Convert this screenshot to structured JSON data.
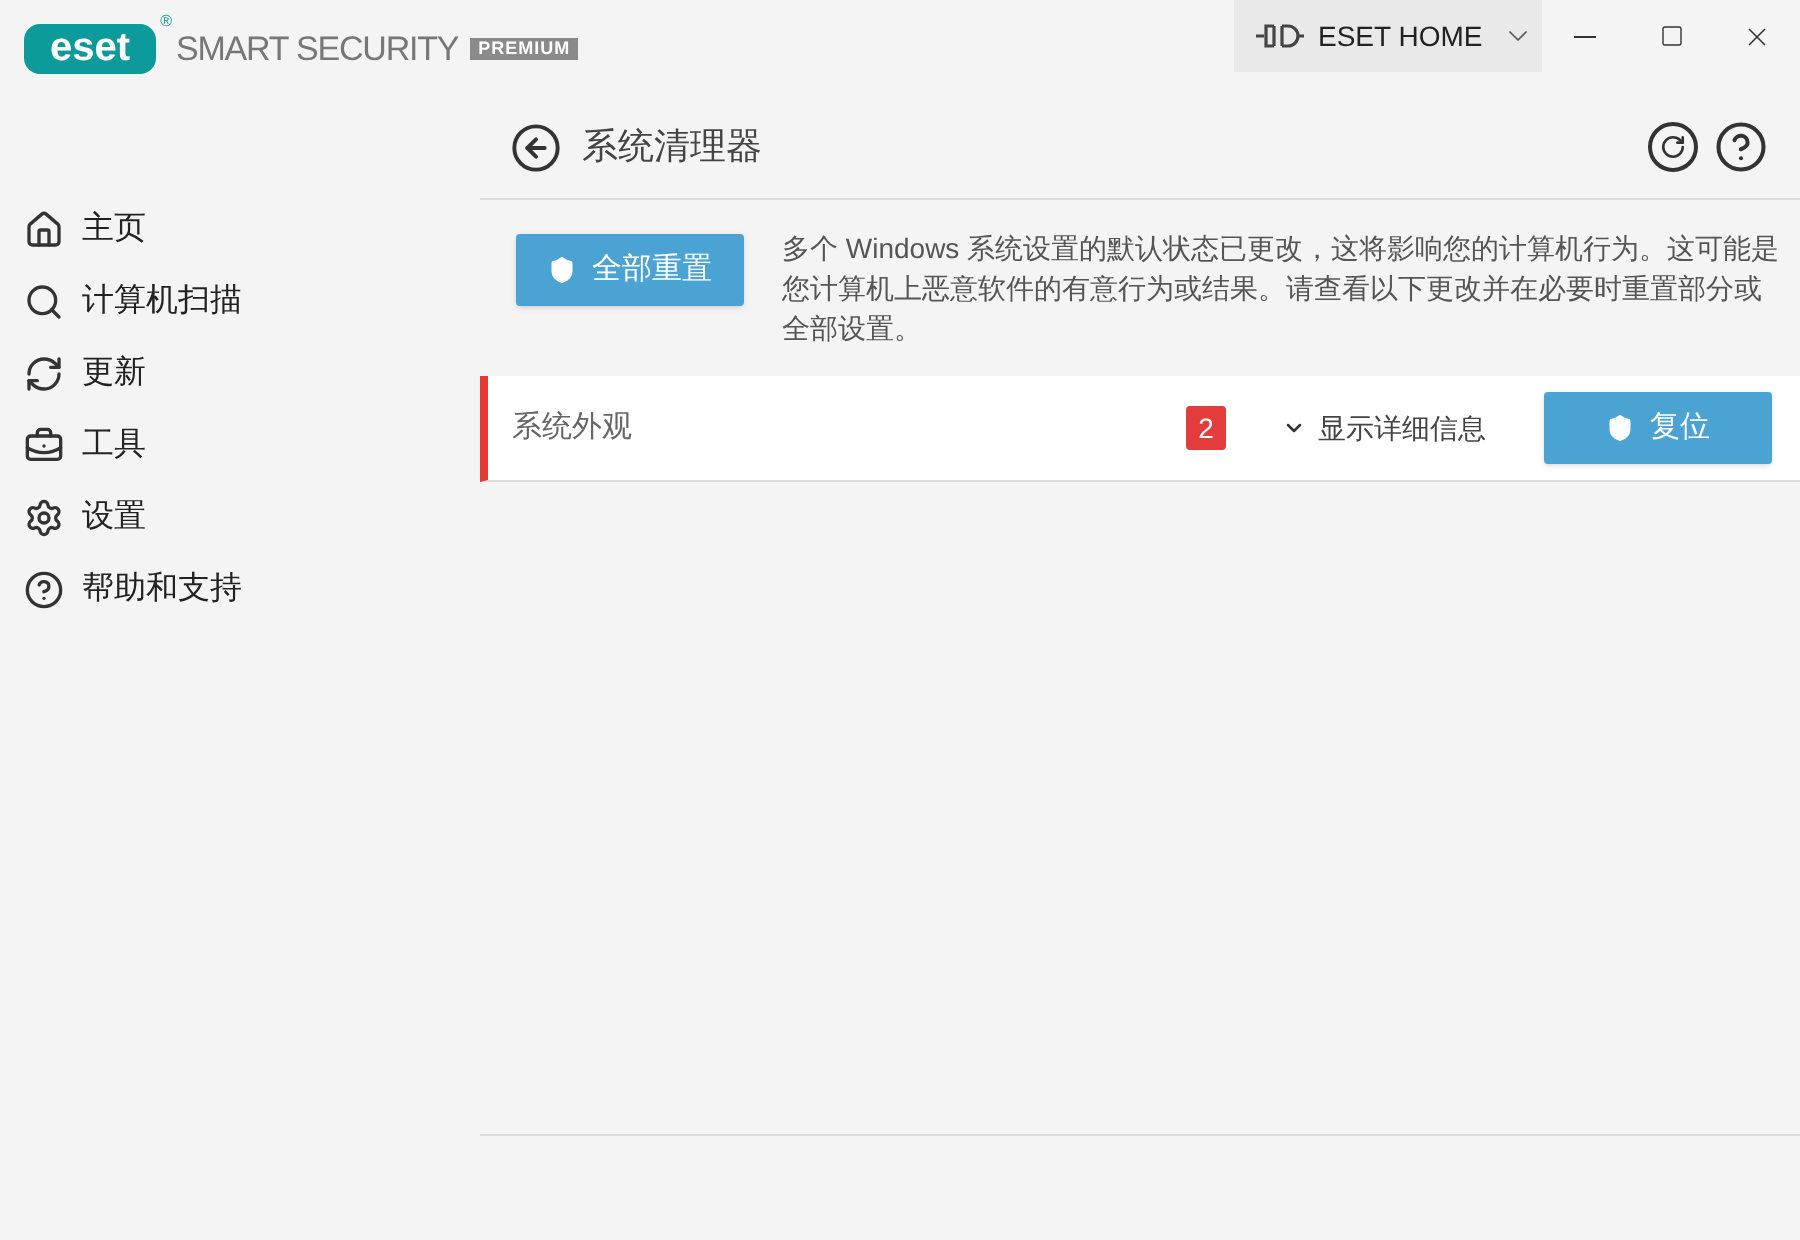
{
  "header": {
    "logo_text": "eset",
    "logo_mark": "®",
    "product_name": "SMART SECURITY",
    "edition_badge": "PREMIUM",
    "account_button": "ESET HOME"
  },
  "sidebar": {
    "items": [
      {
        "label": "主页"
      },
      {
        "label": "计算机扫描"
      },
      {
        "label": "更新"
      },
      {
        "label": "工具"
      },
      {
        "label": "设置"
      },
      {
        "label": "帮助和支持"
      }
    ]
  },
  "page": {
    "title": "系统清理器",
    "reset_all_button": "全部重置",
    "description": "多个 Windows 系统设置的默认状态已更改，这将影响您的计算机行为。这可能是您计算机上恶意软件的有意行为或结果。请查看以下更改并在必要时重置部分或全部设置。"
  },
  "changes": [
    {
      "name": "系统外观",
      "count": "2",
      "details_toggle": "显示详细信息",
      "expanded": false,
      "reset_button": "复位"
    }
  ]
}
